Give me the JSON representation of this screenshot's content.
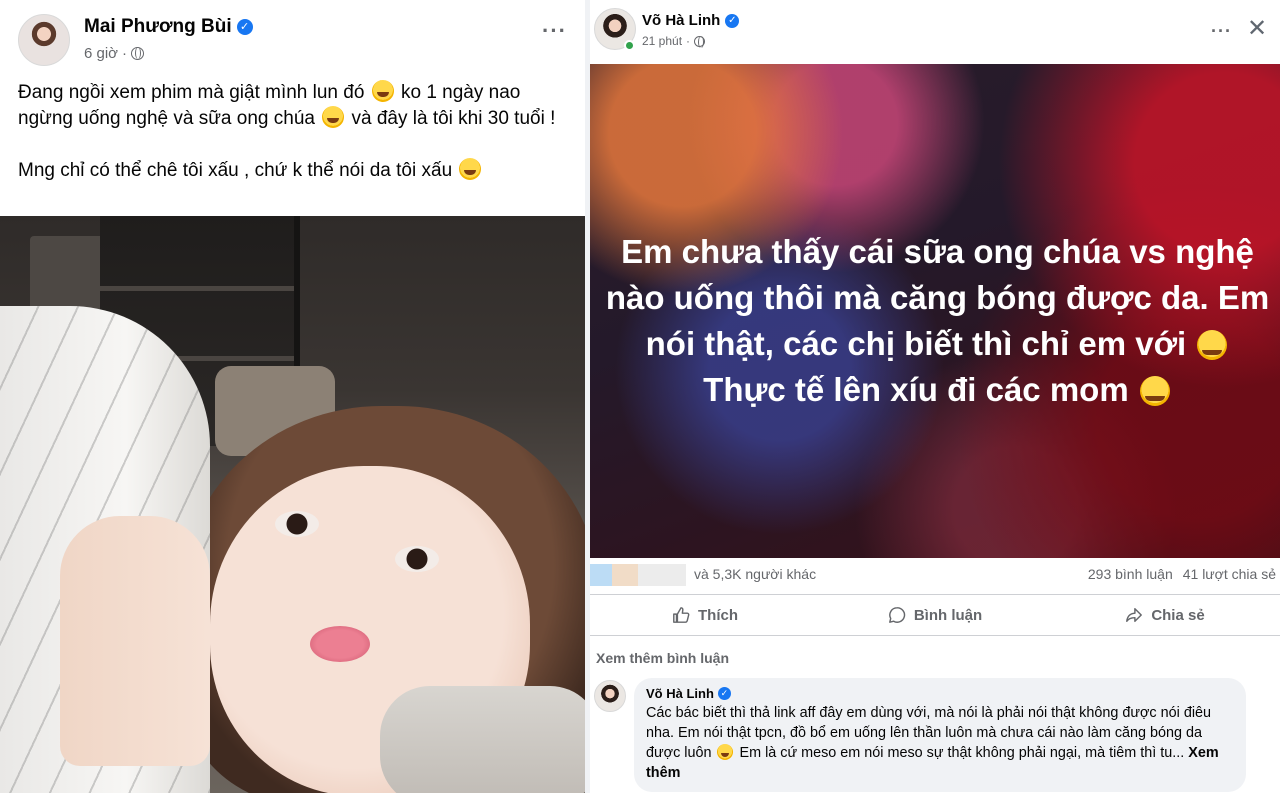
{
  "left_post": {
    "author": "Mai Phương Bùi",
    "time": "6 giờ",
    "separator": "·",
    "paragraph1_part1": "Đang ngồi xem phim mà giật mình lun đó",
    "paragraph1_part2": "ko 1 ngày nao ngừng uống nghệ và sữa ong chúa",
    "paragraph1_part3": "và đây là tôi khi 30 tuổi !",
    "paragraph2": "Mng chỉ có thể chê tôi xấu , chứ k thể nói da tôi xấu",
    "more_icon": "more-horizontal-icon",
    "privacy_icon": "globe-icon"
  },
  "right_post": {
    "author": "Võ Hà Linh",
    "time": "21 phút",
    "separator": "·",
    "image_text_part1": "Em chưa thấy cái sữa ong chúa vs nghệ nào uống thôi mà căng bóng được da. Em nói thật, các chị biết thì chỉ em với",
    "image_text_part2": "Thực tế lên xíu đi các mom",
    "reactions_others": "và 5,3K người khác",
    "comments_count": "293 bình luận",
    "shares_count": "41 lượt chia sẻ",
    "actions": {
      "like": "Thích",
      "comment": "Bình luận",
      "share": "Chia sẻ"
    },
    "see_more_comments": "Xem thêm bình luận",
    "close_icon": "close-icon"
  },
  "comment": {
    "author": "Võ Hà Linh",
    "text_part1": "Các bác biết thì thả link aff đây em dùng với, mà nói là phải nói thật không được nói điêu nha. Em nói thật tpcn, đồ bổ em uống lên thần luôn mà chưa cái nào làm căng bóng da được luôn",
    "text_part2": "Em là cứ meso em nói meso sự thật không phải ngại, mà tiêm thì tu...",
    "see_more": "Xem thêm"
  },
  "colors": {
    "verified_blue": "#1877f2",
    "secondary_text": "#65676b",
    "online_green": "#31a24c",
    "comment_bg": "#f0f2f5"
  }
}
